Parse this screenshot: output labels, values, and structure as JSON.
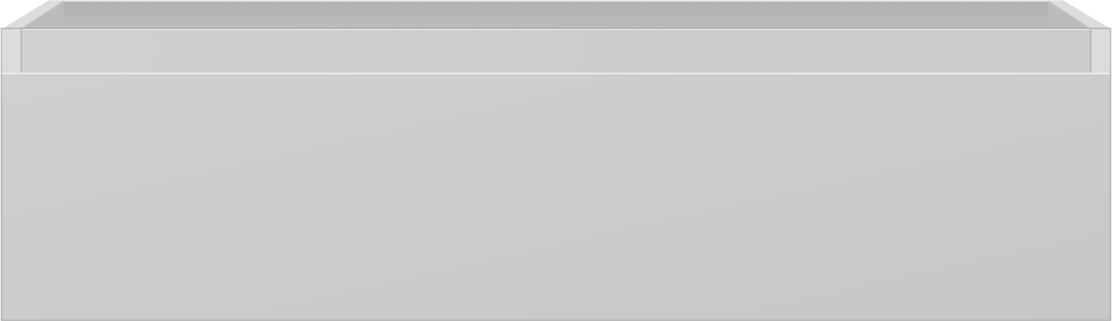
{
  "object": {
    "kind": "open-top drawer box",
    "colors": {
      "body": "#cbcbc9",
      "body_light": "#d0d0ce",
      "body_dark": "#c7c7c5",
      "rim": "#dcdcda",
      "inner_back": "#b0b0b0",
      "inner_side": "#bcbcbc",
      "edge_line": "#a8a8a6",
      "highlight": "#f2f2f2"
    }
  }
}
